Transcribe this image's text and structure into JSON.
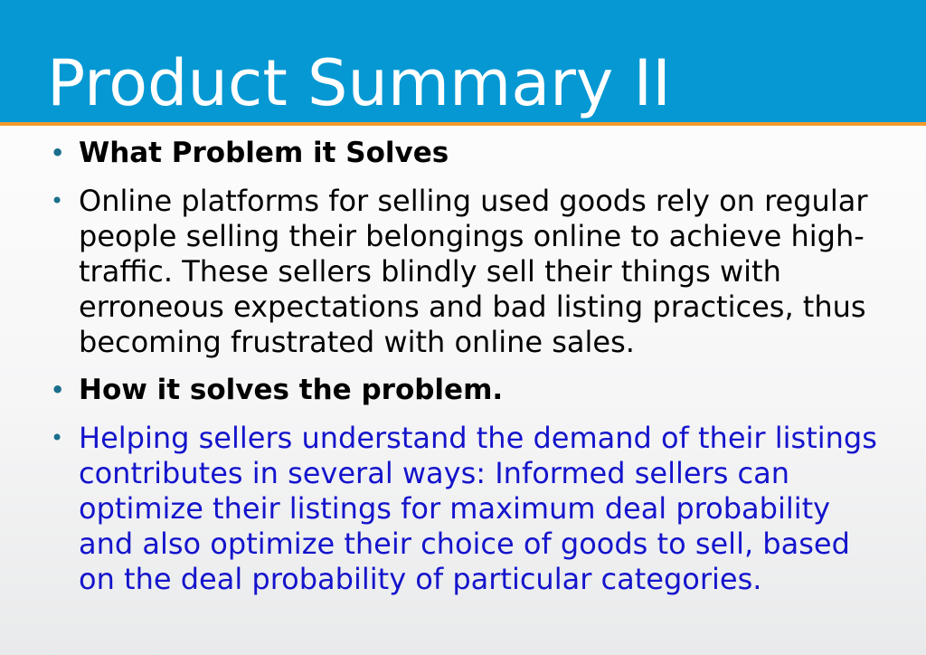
{
  "slide": {
    "title": "Product Summary II",
    "colors": {
      "title_bar": "#0598d3",
      "accent_line": "#f39a2b",
      "bullet": "#1a6f8c",
      "highlight_text": "#1414cc"
    },
    "bullet_icon": "round-bullet",
    "bullets": [
      {
        "text": "What Problem it Solves",
        "bold": true
      },
      {
        "text": "Online platforms for selling used goods rely on regular people selling their belongings online to achieve high-traffic. These sellers blindly sell their things with erroneous expectations and bad listing practices, thus becoming frustrated with online sales."
      },
      {
        "text": "How it solves the problem.",
        "bold": true
      },
      {
        "text": "Helping sellers understand the demand of their listings contributes in several ways: Informed sellers can optimize their listings for maximum deal probability and also optimize their choice of goods to sell, based on the deal probability of particular categories.",
        "color": "blue"
      }
    ]
  }
}
